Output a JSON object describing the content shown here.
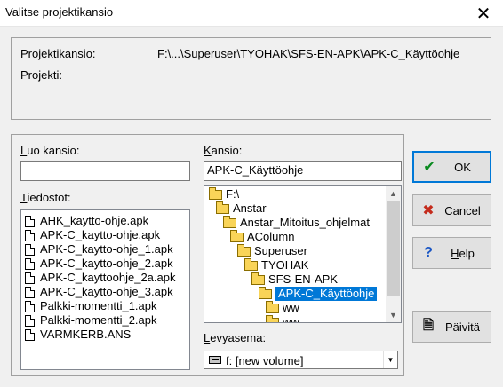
{
  "window": {
    "title": "Valitse projektikansio",
    "close_glyph": "✕"
  },
  "info": {
    "folder_label": "Projektikansio:",
    "folder_value": "F:\\...\\Superuser\\TYOHAK\\SFS-EN-APK\\APK-C_Käyttöohje",
    "project_label": "Projekti:",
    "project_value": ""
  },
  "create_folder": {
    "label_u": "L",
    "label_rest": "uo kansio:",
    "value": ""
  },
  "files": {
    "label_u": "T",
    "label_rest": "iedostot:",
    "items": [
      "AHK_kaytto-ohje.apk",
      "APK-C_kaytto-ohje.apk",
      "APK-C_kaytto-ohje_1.apk",
      "APK-C_kaytto-ohje_2.apk",
      "APK-C_kayttoohje_2a.apk",
      "APK-C_kaytto-ohje_3.apk",
      "Palkki-momentti_1.apk",
      "Palkki-momentti_2.apk",
      "VARMKERB.ANS"
    ]
  },
  "folder": {
    "label_u": "K",
    "label_rest": "ansio:",
    "value": "APK-C_Käyttöohje",
    "tree": [
      {
        "name": "F:\\",
        "indent": 0
      },
      {
        "name": "Anstar",
        "indent": 1
      },
      {
        "name": "Anstar_Mitoitus_ohjelmat",
        "indent": 2
      },
      {
        "name": "AColumn",
        "indent": 3
      },
      {
        "name": "Superuser",
        "indent": 4
      },
      {
        "name": "TYOHAK",
        "indent": 5
      },
      {
        "name": "SFS-EN-APK",
        "indent": 6
      },
      {
        "name": "APK-C_Käyttöohje",
        "indent": 7,
        "selected": true
      },
      {
        "name": "ww",
        "indent": 8
      },
      {
        "name": "ww",
        "indent": 8
      }
    ]
  },
  "drive": {
    "label_u": "L",
    "label_rest": "evyasema:",
    "value": "f: [new volume]"
  },
  "buttons": {
    "ok": "OK",
    "cancel": "Cancel",
    "help": "Help",
    "help_u": "H",
    "help_rest": "elp",
    "refresh": "Päivitä"
  },
  "colors": {
    "selection": "#0078d7",
    "ok_check": "#0a8a1f",
    "cancel_x": "#c42b1c",
    "help_q": "#1a56c4"
  }
}
